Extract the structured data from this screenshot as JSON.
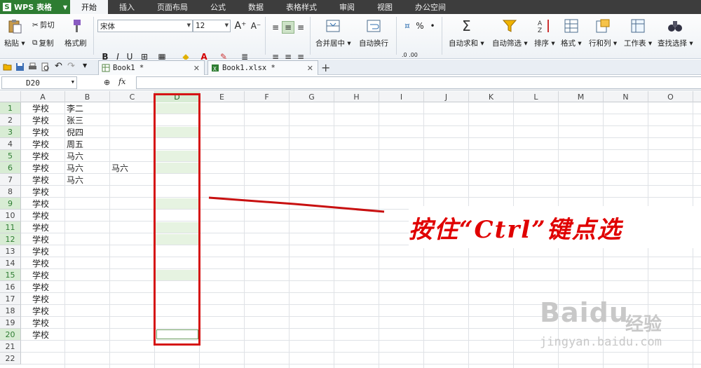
{
  "app": {
    "logo": "WPS 表格",
    "logo_letter": "S"
  },
  "menu": [
    "开始",
    "插入",
    "页面布局",
    "公式",
    "数据",
    "表格样式",
    "审阅",
    "视图",
    "办公空间"
  ],
  "ribbon": {
    "paste": "粘贴",
    "cut": "剪切",
    "copy": "复制",
    "format_painter": "格式刷",
    "font_name": "宋体",
    "font_size": "12",
    "bold": "B",
    "italic": "I",
    "underline": "U",
    "merge_center": "合并居中",
    "wrap_text": "自动换行",
    "percent": "%",
    "dec_inc": ".0 .00",
    "dec_dec": ".00 .0",
    "autosum": "自动求和",
    "autofilter": "自动筛选",
    "sort": "排序",
    "format": "格式",
    "rows_cols": "行和列",
    "worksheet": "工作表",
    "find_select": "查找选择"
  },
  "tabs": [
    {
      "label": "Book1 *"
    },
    {
      "label": "Book1.xlsx *"
    }
  ],
  "formula_bar": {
    "name_box": "D20",
    "fx": "fx"
  },
  "columns": [
    "A",
    "B",
    "C",
    "D",
    "E",
    "F",
    "G",
    "H",
    "I",
    "J",
    "K",
    "L",
    "M",
    "N",
    "O"
  ],
  "selected_column": "D",
  "rows": [
    "1",
    "2",
    "3",
    "4",
    "5",
    "6",
    "7",
    "8",
    "9",
    "10",
    "11",
    "12",
    "13",
    "14",
    "15",
    "16",
    "17",
    "18",
    "19",
    "20",
    "21",
    "22"
  ],
  "selected_rows": [
    1,
    3,
    5,
    6,
    9,
    11,
    12,
    15,
    20
  ],
  "cells": {
    "A": [
      "学校",
      "学校",
      "学校",
      "学校",
      "学校",
      "学校",
      "学校",
      "学校",
      "学校",
      "学校",
      "学校",
      "学校",
      "学校",
      "学校",
      "学校",
      "学校",
      "学校",
      "学校",
      "学校",
      "学校"
    ],
    "B": [
      "李二",
      "张三",
      "倪四",
      "周五",
      "马六",
      "马六",
      "马六"
    ],
    "C6": "马六"
  },
  "annotation": "按住“Ctrl”键点选",
  "watermark": {
    "brand": "Baidu",
    "product": "经验",
    "url": "jingyan.baidu.com"
  },
  "colors": {
    "accent_green": "#2e7d32",
    "annotation_red": "#d51414",
    "selection_fill": "#e6f3e1"
  }
}
